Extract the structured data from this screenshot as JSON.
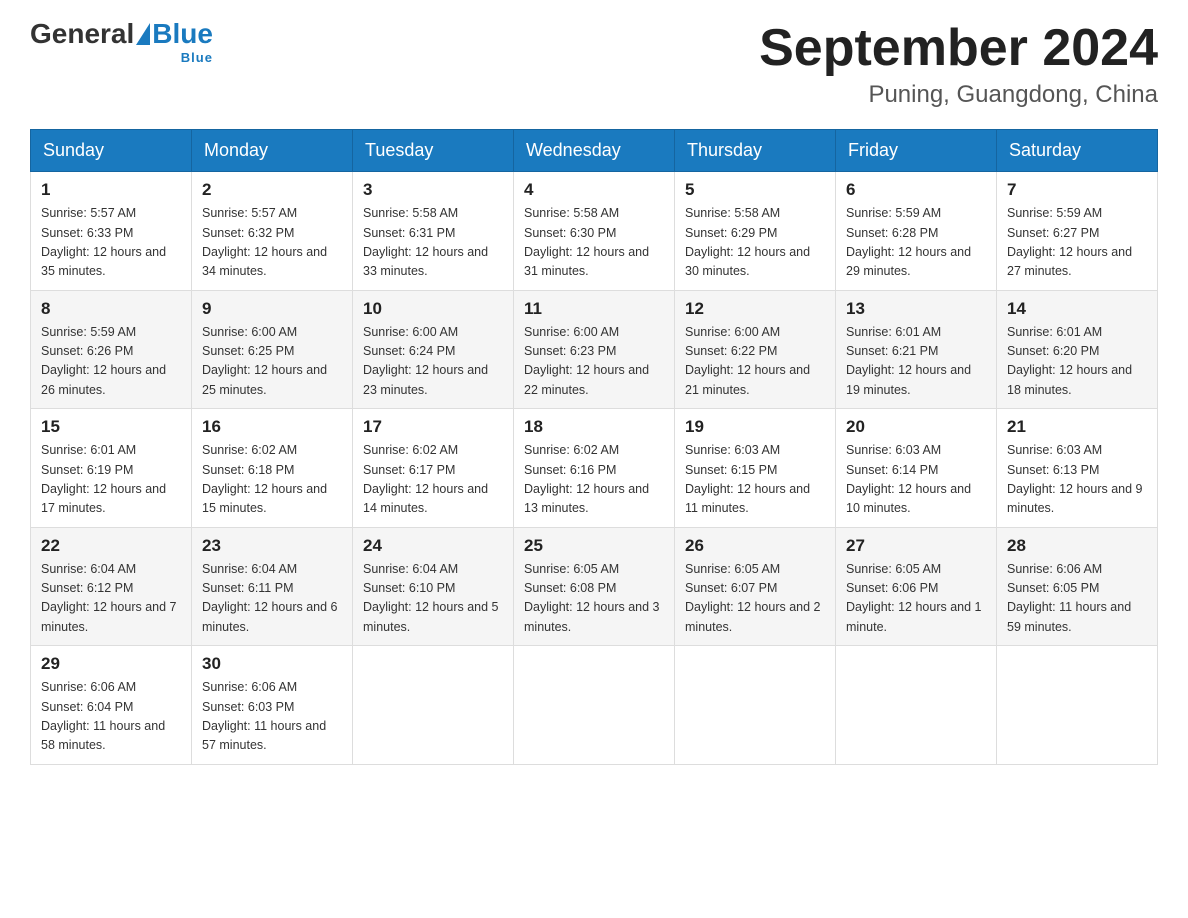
{
  "header": {
    "logo": {
      "general": "General",
      "blue": "Blue",
      "tagline": "Blue"
    },
    "main_title": "September 2024",
    "subtitle": "Puning, Guangdong, China"
  },
  "calendar": {
    "days_of_week": [
      "Sunday",
      "Monday",
      "Tuesday",
      "Wednesday",
      "Thursday",
      "Friday",
      "Saturday"
    ],
    "weeks": [
      [
        {
          "day": "1",
          "sunrise": "Sunrise: 5:57 AM",
          "sunset": "Sunset: 6:33 PM",
          "daylight": "Daylight: 12 hours and 35 minutes."
        },
        {
          "day": "2",
          "sunrise": "Sunrise: 5:57 AM",
          "sunset": "Sunset: 6:32 PM",
          "daylight": "Daylight: 12 hours and 34 minutes."
        },
        {
          "day": "3",
          "sunrise": "Sunrise: 5:58 AM",
          "sunset": "Sunset: 6:31 PM",
          "daylight": "Daylight: 12 hours and 33 minutes."
        },
        {
          "day": "4",
          "sunrise": "Sunrise: 5:58 AM",
          "sunset": "Sunset: 6:30 PM",
          "daylight": "Daylight: 12 hours and 31 minutes."
        },
        {
          "day": "5",
          "sunrise": "Sunrise: 5:58 AM",
          "sunset": "Sunset: 6:29 PM",
          "daylight": "Daylight: 12 hours and 30 minutes."
        },
        {
          "day": "6",
          "sunrise": "Sunrise: 5:59 AM",
          "sunset": "Sunset: 6:28 PM",
          "daylight": "Daylight: 12 hours and 29 minutes."
        },
        {
          "day": "7",
          "sunrise": "Sunrise: 5:59 AM",
          "sunset": "Sunset: 6:27 PM",
          "daylight": "Daylight: 12 hours and 27 minutes."
        }
      ],
      [
        {
          "day": "8",
          "sunrise": "Sunrise: 5:59 AM",
          "sunset": "Sunset: 6:26 PM",
          "daylight": "Daylight: 12 hours and 26 minutes."
        },
        {
          "day": "9",
          "sunrise": "Sunrise: 6:00 AM",
          "sunset": "Sunset: 6:25 PM",
          "daylight": "Daylight: 12 hours and 25 minutes."
        },
        {
          "day": "10",
          "sunrise": "Sunrise: 6:00 AM",
          "sunset": "Sunset: 6:24 PM",
          "daylight": "Daylight: 12 hours and 23 minutes."
        },
        {
          "day": "11",
          "sunrise": "Sunrise: 6:00 AM",
          "sunset": "Sunset: 6:23 PM",
          "daylight": "Daylight: 12 hours and 22 minutes."
        },
        {
          "day": "12",
          "sunrise": "Sunrise: 6:00 AM",
          "sunset": "Sunset: 6:22 PM",
          "daylight": "Daylight: 12 hours and 21 minutes."
        },
        {
          "day": "13",
          "sunrise": "Sunrise: 6:01 AM",
          "sunset": "Sunset: 6:21 PM",
          "daylight": "Daylight: 12 hours and 19 minutes."
        },
        {
          "day": "14",
          "sunrise": "Sunrise: 6:01 AM",
          "sunset": "Sunset: 6:20 PM",
          "daylight": "Daylight: 12 hours and 18 minutes."
        }
      ],
      [
        {
          "day": "15",
          "sunrise": "Sunrise: 6:01 AM",
          "sunset": "Sunset: 6:19 PM",
          "daylight": "Daylight: 12 hours and 17 minutes."
        },
        {
          "day": "16",
          "sunrise": "Sunrise: 6:02 AM",
          "sunset": "Sunset: 6:18 PM",
          "daylight": "Daylight: 12 hours and 15 minutes."
        },
        {
          "day": "17",
          "sunrise": "Sunrise: 6:02 AM",
          "sunset": "Sunset: 6:17 PM",
          "daylight": "Daylight: 12 hours and 14 minutes."
        },
        {
          "day": "18",
          "sunrise": "Sunrise: 6:02 AM",
          "sunset": "Sunset: 6:16 PM",
          "daylight": "Daylight: 12 hours and 13 minutes."
        },
        {
          "day": "19",
          "sunrise": "Sunrise: 6:03 AM",
          "sunset": "Sunset: 6:15 PM",
          "daylight": "Daylight: 12 hours and 11 minutes."
        },
        {
          "day": "20",
          "sunrise": "Sunrise: 6:03 AM",
          "sunset": "Sunset: 6:14 PM",
          "daylight": "Daylight: 12 hours and 10 minutes."
        },
        {
          "day": "21",
          "sunrise": "Sunrise: 6:03 AM",
          "sunset": "Sunset: 6:13 PM",
          "daylight": "Daylight: 12 hours and 9 minutes."
        }
      ],
      [
        {
          "day": "22",
          "sunrise": "Sunrise: 6:04 AM",
          "sunset": "Sunset: 6:12 PM",
          "daylight": "Daylight: 12 hours and 7 minutes."
        },
        {
          "day": "23",
          "sunrise": "Sunrise: 6:04 AM",
          "sunset": "Sunset: 6:11 PM",
          "daylight": "Daylight: 12 hours and 6 minutes."
        },
        {
          "day": "24",
          "sunrise": "Sunrise: 6:04 AM",
          "sunset": "Sunset: 6:10 PM",
          "daylight": "Daylight: 12 hours and 5 minutes."
        },
        {
          "day": "25",
          "sunrise": "Sunrise: 6:05 AM",
          "sunset": "Sunset: 6:08 PM",
          "daylight": "Daylight: 12 hours and 3 minutes."
        },
        {
          "day": "26",
          "sunrise": "Sunrise: 6:05 AM",
          "sunset": "Sunset: 6:07 PM",
          "daylight": "Daylight: 12 hours and 2 minutes."
        },
        {
          "day": "27",
          "sunrise": "Sunrise: 6:05 AM",
          "sunset": "Sunset: 6:06 PM",
          "daylight": "Daylight: 12 hours and 1 minute."
        },
        {
          "day": "28",
          "sunrise": "Sunrise: 6:06 AM",
          "sunset": "Sunset: 6:05 PM",
          "daylight": "Daylight: 11 hours and 59 minutes."
        }
      ],
      [
        {
          "day": "29",
          "sunrise": "Sunrise: 6:06 AM",
          "sunset": "Sunset: 6:04 PM",
          "daylight": "Daylight: 11 hours and 58 minutes."
        },
        {
          "day": "30",
          "sunrise": "Sunrise: 6:06 AM",
          "sunset": "Sunset: 6:03 PM",
          "daylight": "Daylight: 11 hours and 57 minutes."
        },
        null,
        null,
        null,
        null,
        null
      ]
    ]
  }
}
